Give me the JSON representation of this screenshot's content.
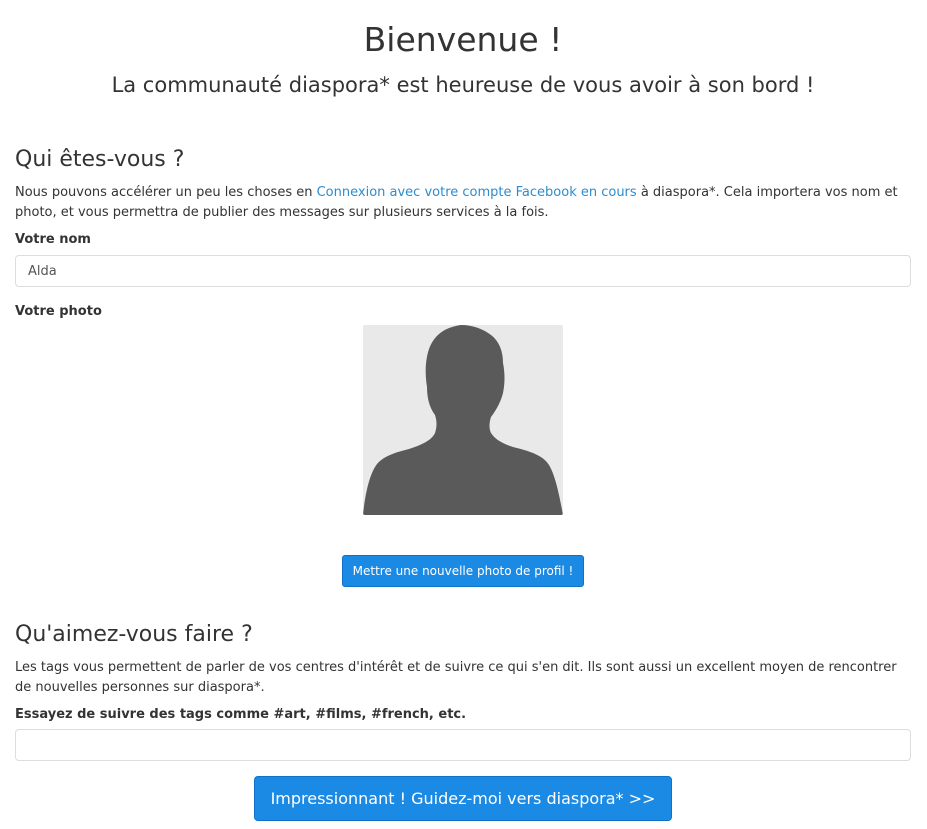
{
  "header": {
    "title": "Bienvenue !",
    "subtitle": "La communauté diaspora* est heureuse de vous avoir à son bord !"
  },
  "who": {
    "title": "Qui êtes-vous ?",
    "desc_before": "Nous pouvons accélérer un peu les choses en ",
    "link_text": "Connexion avec votre compte Facebook en cours",
    "desc_after": " à diaspora*. Cela importera vos nom et photo, et vous permettra de publier des messages sur plusieurs services à la fois.",
    "name_label": "Votre nom",
    "name_value": "Alda",
    "photo_label": "Votre photo",
    "upload_label": "Mettre une nouvelle photo de profil !"
  },
  "interests": {
    "title": "Qu'aimez-vous faire ?",
    "desc": "Les tags vous permettent de parler de vos centres d'intérêt et de suivre ce qui s'en dit. Ils sont aussi un excellent moyen de rencontrer de nouvelles personnes sur diaspora*.",
    "tags_label": "Essayez de suivre des tags comme #art, #films, #french, etc.",
    "tags_value": ""
  },
  "submit_label": "Impressionnant ! Guidez-moi vers diaspora* >>",
  "colors": {
    "link": "#2e8ccd",
    "button": "#1b8ae5",
    "avatar_bg": "#e9e9e9",
    "avatar_fg": "#5a5a5a"
  }
}
